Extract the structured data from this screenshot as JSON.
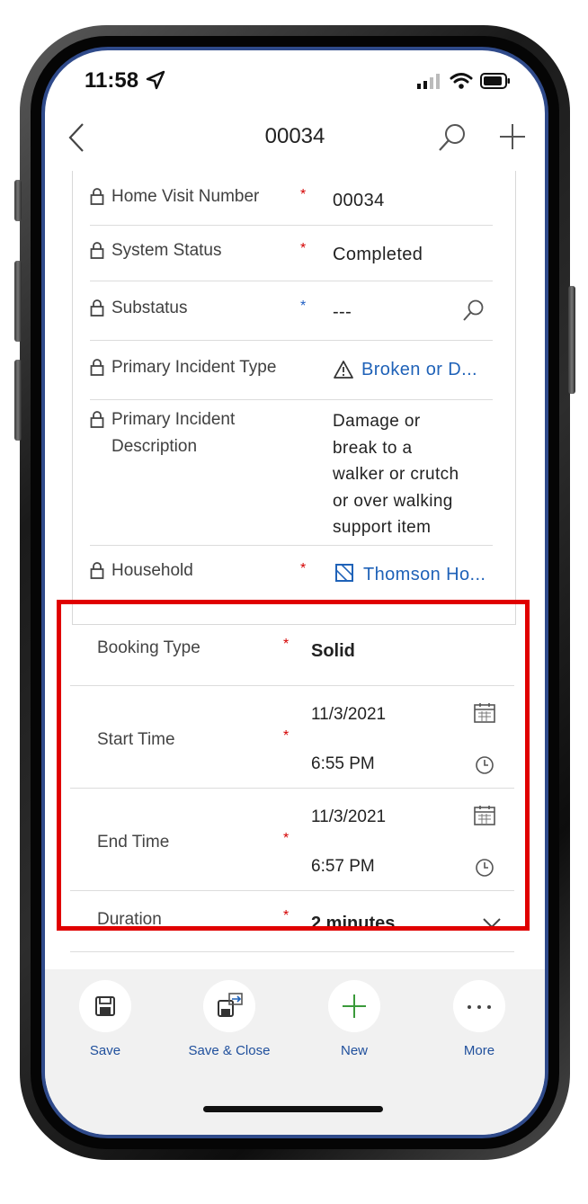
{
  "status_bar": {
    "time": "11:58"
  },
  "header": {
    "title": "00034"
  },
  "locked_fields": [
    {
      "label": "Home Visit Number",
      "required": true,
      "value": "00034"
    },
    {
      "label": "System Status",
      "required": true,
      "value": "Completed"
    },
    {
      "label": "Substatus",
      "recommended": true,
      "value": "---"
    },
    {
      "label": "Primary Incident Type",
      "value": "Broken or D..."
    },
    {
      "label_line1": "Primary Incident",
      "label_line2": "Description",
      "value_lines": [
        "Damage or",
        "break to a",
        "walker or crutch",
        "or over walking",
        "support item"
      ]
    },
    {
      "label": "Household",
      "required": true,
      "value": "Thomson Ho..."
    }
  ],
  "booking": {
    "booking_type": {
      "label": "Booking Type",
      "value": "Solid"
    },
    "start_time": {
      "label": "Start Time",
      "date": "11/3/2021",
      "time": "6:55 PM"
    },
    "end_time": {
      "label": "End Time",
      "date": "11/3/2021",
      "time": "6:57 PM"
    },
    "duration": {
      "label": "Duration",
      "value": "2 minutes"
    }
  },
  "required_marker": "*",
  "toolbar": {
    "save": "Save",
    "save_close": "Save & Close",
    "new": "New",
    "more": "More"
  },
  "colors": {
    "link": "#1f62b8",
    "required": "#d40000",
    "highlight": "#e00000",
    "toolbar_bg": "#f1f1f1"
  }
}
